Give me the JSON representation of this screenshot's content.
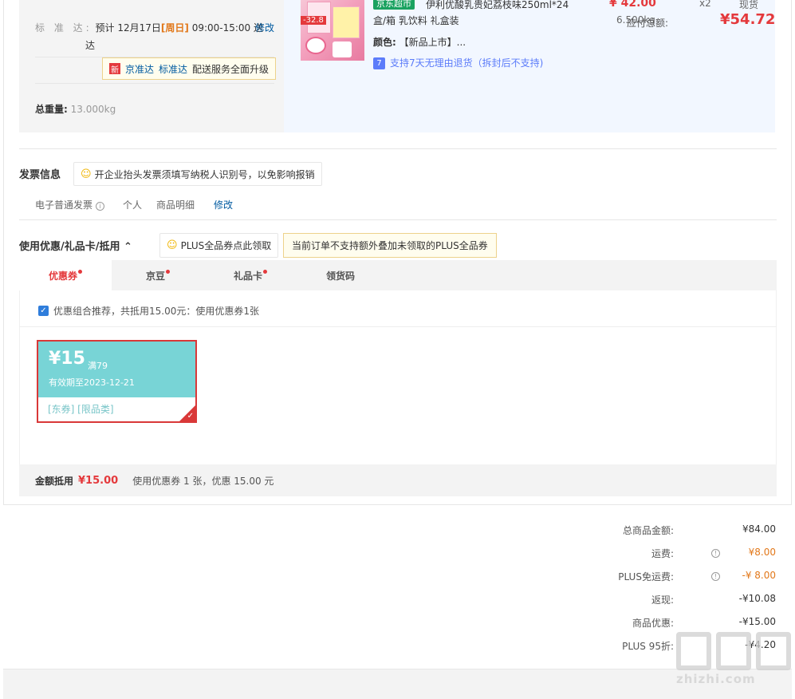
{
  "shipping": {
    "label": "标 准 达:",
    "estimate_prefix": "预计 12月17日",
    "weekday": "[周日]",
    "time": "09:00-15:00 送",
    "time_cont": "达",
    "modify": "修改",
    "tip_badge": "新",
    "tip_link1": "京准达",
    "tip_link2": "标准达",
    "tip_text": "配送服务全面升级",
    "weight_label": "总重量:",
    "weight_value": "13.000kg"
  },
  "product": {
    "store_tag": "京东超市",
    "title": "伊利优酸乳贵妃荔枝味250ml*24盒/箱 乳饮料 礼盒装",
    "color_label": "颜色:",
    "color_value": "【新品上市】...",
    "return_icon": "7",
    "return_text": "支持7天无理由退货（拆封后不支持)",
    "img_badge": "-32.8",
    "price": "¥ 42.00",
    "weight": "6.500kg",
    "qty": "x2",
    "stock": "现货"
  },
  "invoice": {
    "title": "发票信息",
    "tip": "开企业抬头发票须填写纳税人识别号，以免影响报销",
    "type": "电子普通发票",
    "title_type": "个人",
    "content": "商品明细",
    "modify": "修改"
  },
  "discount": {
    "title": "使用优惠/礼品卡/抵用",
    "tip1": "PLUS全品券点此领取",
    "tip2": "当前订单不支持额外叠加未领取的PLUS全品券",
    "tabs": [
      "优惠券",
      "京豆",
      "礼品卡",
      "领货码"
    ],
    "recommend": "优惠组合推荐，共抵用15.00元：使用优惠券1张",
    "coupon": {
      "amount": "¥15",
      "condition": "满79",
      "expiry": "有效期至2023-12-21",
      "tags": "[东券]  [限品类]"
    },
    "bar_label": "金额抵用",
    "bar_amount": "¥15.00",
    "bar_note": "使用优惠券 1 张，优惠 15.00 元"
  },
  "summary": {
    "rows": [
      {
        "label": "总商品金额:",
        "value": "¥84.00"
      },
      {
        "label": "运费:",
        "value": "¥8.00"
      },
      {
        "label": "PLUS免运费:",
        "value": "-¥ 8.00"
      },
      {
        "label": "返现:",
        "value": "-¥10.08"
      },
      {
        "label": "商品优惠:",
        "value": "-¥15.00"
      },
      {
        "label": "PLUS 95折:",
        "value": "-¥4.20"
      }
    ],
    "total_label": "应付总额:",
    "total_value": "¥54.72"
  },
  "watermark": {
    "text": "zhizhi.com"
  },
  "colors": {
    "accent": "#e4393c",
    "link": "#005aa0",
    "coupon": "#78d4d6"
  }
}
